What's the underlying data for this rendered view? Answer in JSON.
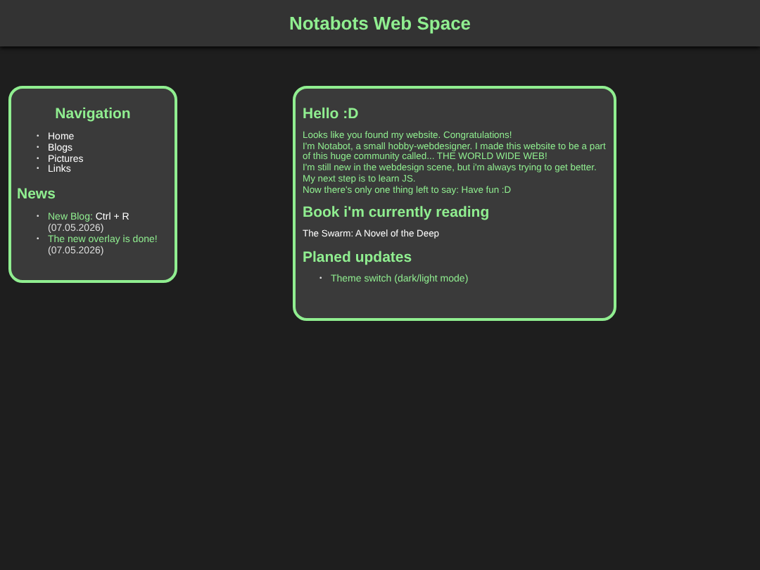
{
  "header": {
    "title": "Notabots Web Space"
  },
  "navigation": {
    "heading": "Navigation",
    "bullet": "•",
    "links": [
      "Home",
      "Blogs",
      "Pictures",
      "Links"
    ]
  },
  "news": {
    "heading": "News",
    "bullet": "•",
    "items": [
      {
        "title": "New Blog:",
        "detail": "Ctrl + R",
        "date": "(07.05.2026)"
      },
      {
        "title": "The new overlay is done!",
        "date": "(07.05.2026)"
      }
    ]
  },
  "main": {
    "sections": [
      {
        "kind": "lines",
        "heading": "Hello :D",
        "lines": [
          "Looks like you found my website. Congratulations!",
          "I'm Notabot, a small hobby-webdesigner. I made this website to be a part of this huge community called... THE WORLD WIDE WEB!",
          "I'm still new in the webdesign scene, but i'm always trying to get better.",
          "My next step is to learn JS.",
          "Now there's only one thing left to say: Have fun :D"
        ]
      },
      {
        "kind": "text",
        "heading": "Book i'm currently reading",
        "text": "The Swarm: A Novel of the Deep"
      },
      {
        "kind": "list",
        "heading": "Planed updates",
        "bullet": "•",
        "items": [
          "Theme switch (dark/light mode)"
        ]
      }
    ]
  }
}
